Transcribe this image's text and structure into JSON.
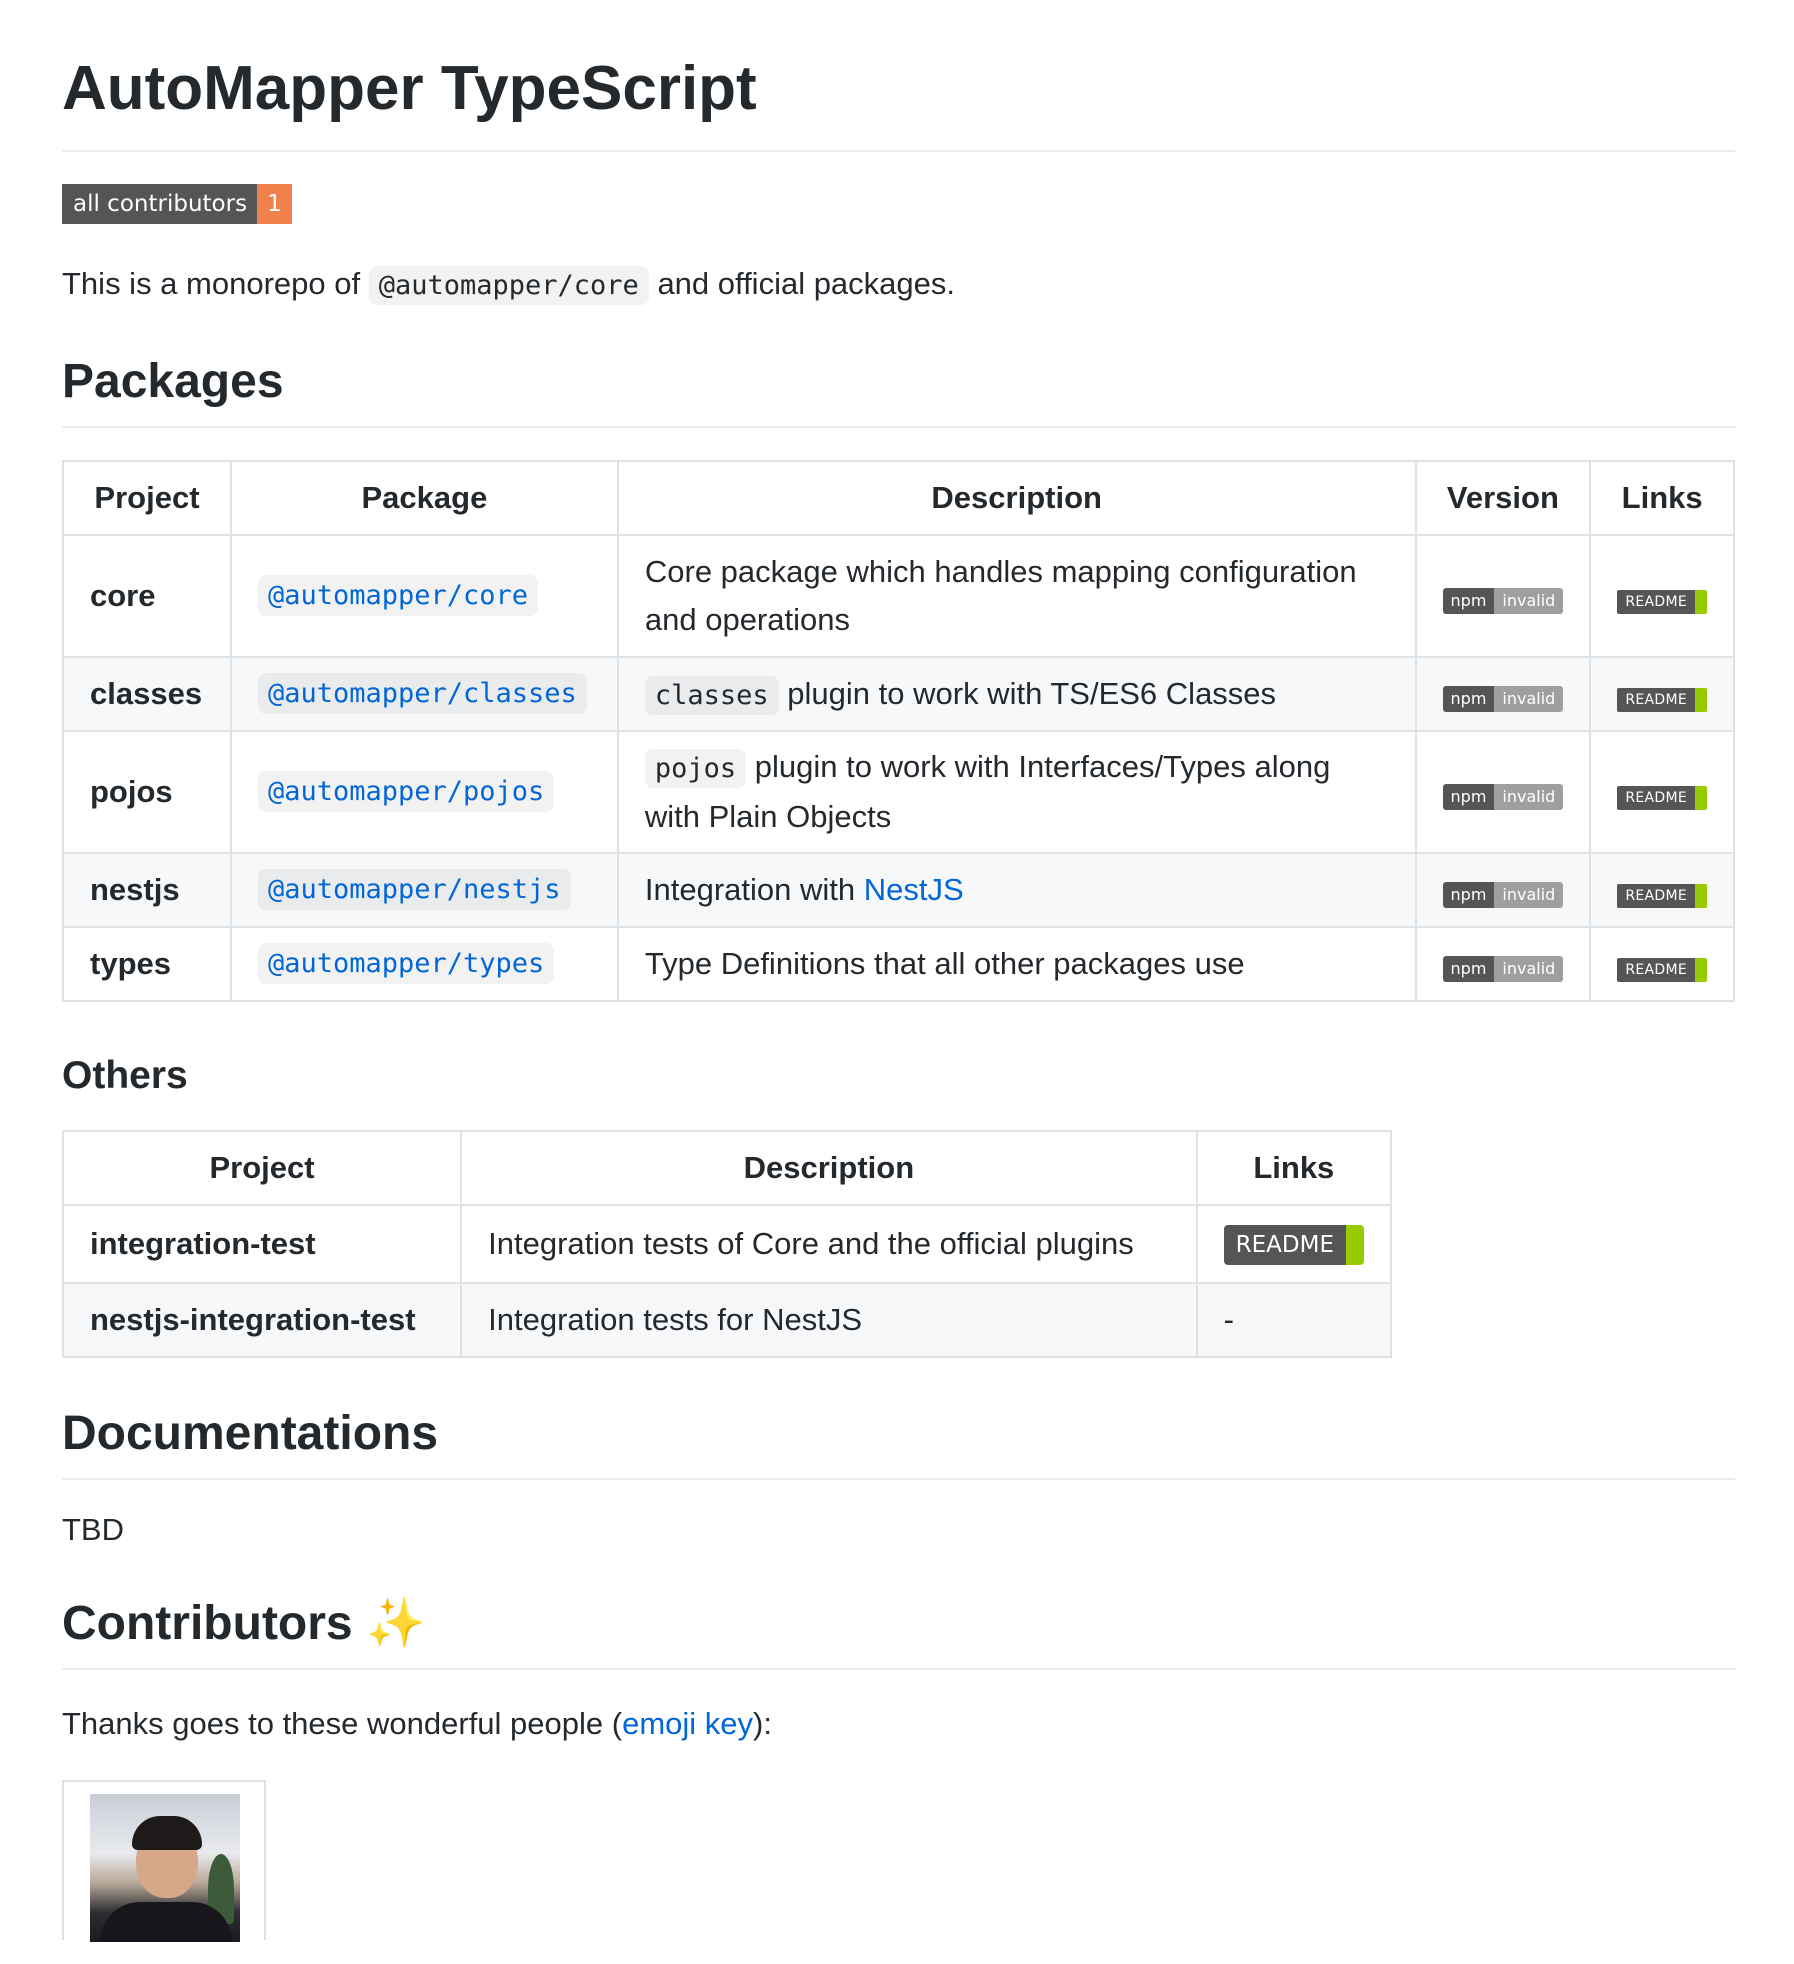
{
  "title": "AutoMapper TypeScript",
  "badge": {
    "label": "all contributors",
    "count": "1"
  },
  "intro": {
    "prefix": "This is a monorepo of",
    "code": "@automapper/core",
    "suffix": "and official packages."
  },
  "packages": {
    "heading": "Packages",
    "headers": [
      "Project",
      "Package",
      "Description",
      "Version",
      "Links"
    ],
    "version_badge": {
      "left": "npm",
      "right": "invalid"
    },
    "links_badge": "README",
    "rows": [
      {
        "project": "core",
        "package": "@automapper/core",
        "desc_code": "",
        "desc_text": "Core package which handles mapping configuration and operations",
        "desc_link": ""
      },
      {
        "project": "classes",
        "package": "@automapper/classes",
        "desc_code": "classes",
        "desc_text": "plugin to work with TS/ES6 Classes",
        "desc_link": ""
      },
      {
        "project": "pojos",
        "package": "@automapper/pojos",
        "desc_code": "pojos",
        "desc_text": "plugin to work with Interfaces/Types along with Plain Objects",
        "desc_link": ""
      },
      {
        "project": "nestjs",
        "package": "@automapper/nestjs",
        "desc_code": "",
        "desc_text": "Integration with",
        "desc_link": "NestJS"
      },
      {
        "project": "types",
        "package": "@automapper/types",
        "desc_code": "",
        "desc_text": "Type Definitions that all other packages use",
        "desc_link": ""
      }
    ]
  },
  "others": {
    "heading": "Others",
    "headers": [
      "Project",
      "Description",
      "Links"
    ],
    "rows": [
      {
        "project": "integration-test",
        "description": "Integration tests of Core and the official plugins",
        "link": "README"
      },
      {
        "project": "nestjs-integration-test",
        "description": "Integration tests for NestJS",
        "link": "-"
      }
    ]
  },
  "documentations": {
    "heading": "Documentations",
    "body": "TBD"
  },
  "contributors": {
    "heading": "Contributors",
    "emoji": "✨",
    "thanks_prefix": "Thanks goes to these wonderful people (",
    "thanks_link": "emoji key",
    "thanks_suffix": "):"
  },
  "colors": {
    "text": "#24292e",
    "link": "#0366d6",
    "badge_dark": "#555555",
    "badge_orange": "#f1814a",
    "badge_green": "#97ca00",
    "border": "#dfe2e5"
  }
}
